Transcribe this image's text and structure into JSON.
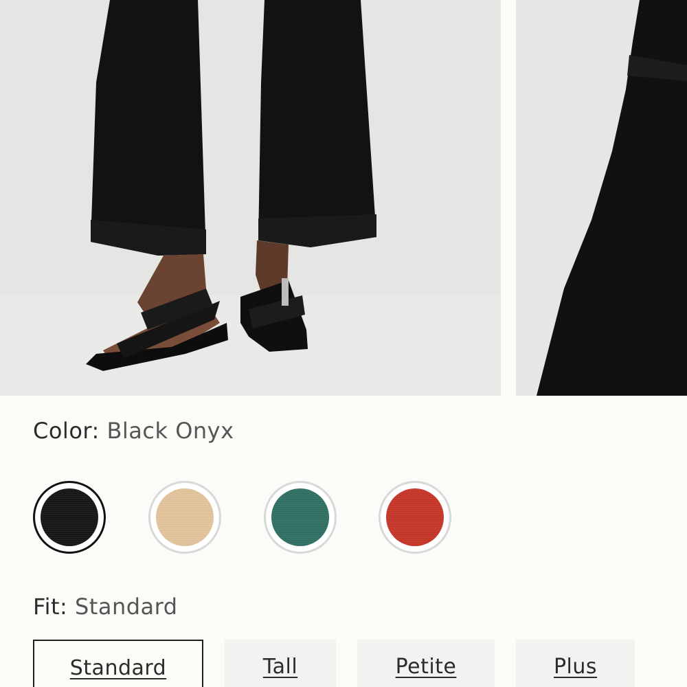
{
  "gallery": {
    "images": [
      {
        "name": "product-photo-model-legs",
        "alt": ""
      },
      {
        "name": "product-photo-fabric-detail",
        "alt": ""
      }
    ]
  },
  "color": {
    "label": "Color:",
    "selected_value": "Black Onyx",
    "swatches": [
      {
        "color": "#141414",
        "selected": true
      },
      {
        "color": "#e3c59c",
        "selected": false
      },
      {
        "color": "#2f6f62",
        "selected": false
      },
      {
        "color": "#c73527",
        "selected": false
      }
    ]
  },
  "fit": {
    "label": "Fit:",
    "selected_value": "Standard",
    "options": [
      {
        "label": "Standard",
        "selected": true
      },
      {
        "label": "Tall",
        "selected": false
      },
      {
        "label": "Petite",
        "selected": false
      },
      {
        "label": "Plus",
        "selected": false
      }
    ]
  }
}
